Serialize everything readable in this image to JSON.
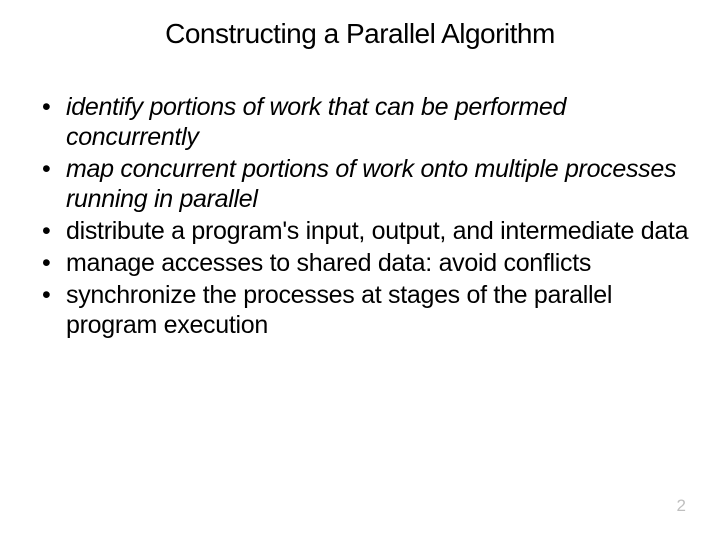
{
  "title": "Constructing a Parallel Algorithm",
  "bullets": [
    {
      "text": "identify portions of work that can be performed concurrently",
      "italic": true
    },
    {
      "text": "map concurrent portions of work onto multiple processes running in parallel",
      "italic": true
    },
    {
      "text": "distribute a program's input, output, and intermediate data",
      "italic": false
    },
    {
      "text": "manage accesses to shared data: avoid conflicts",
      "italic": false
    },
    {
      "text": "synchronize the processes at stages of the parallel program execution",
      "italic": false
    }
  ],
  "page_number": "2"
}
